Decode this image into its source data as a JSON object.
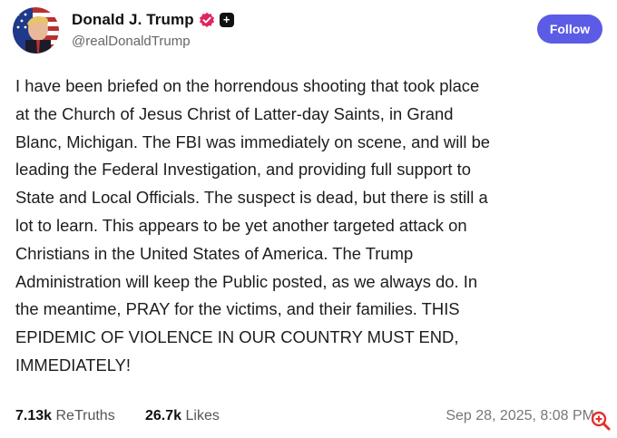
{
  "author": {
    "display_name": "Donald J. Trump",
    "handle": "@realDonaldTrump",
    "verified_icon": "verified-badge-icon",
    "plus_icon": "plus-badge-icon",
    "plus_glyph": "+"
  },
  "follow_label": "Follow",
  "post": {
    "text": "I have been briefed on the horrendous shooting that took place\nat the Church of Jesus Christ of Latter-day Saints, in Grand\nBlanc, Michigan. The FBI was immediately on scene, and will be\nleading the Federal Investigation, and providing full support to\nState and Local Officials. The suspect is dead, but there is still a\nlot to learn. This appears to be yet another targeted attack on\nChristians in the United States of America. The Trump\nAdministration will keep the Public posted, as we always do. In\nthe meantime, PRAY for the victims, and their families. THIS\nEPIDEMIC OF VIOLENCE IN OUR COUNTRY MUST END,\nIMMEDIATELY!"
  },
  "stats": {
    "retruths_count": "7.13k",
    "retruths_label": "ReTruths",
    "likes_count": "26.7k",
    "likes_label": "Likes"
  },
  "timestamp": "Sep 28, 2025, 8:08 PM",
  "colors": {
    "follow_button": "#5b5be6",
    "verified_badge": "#e0245e",
    "zoom_icon": "#e0302a"
  }
}
